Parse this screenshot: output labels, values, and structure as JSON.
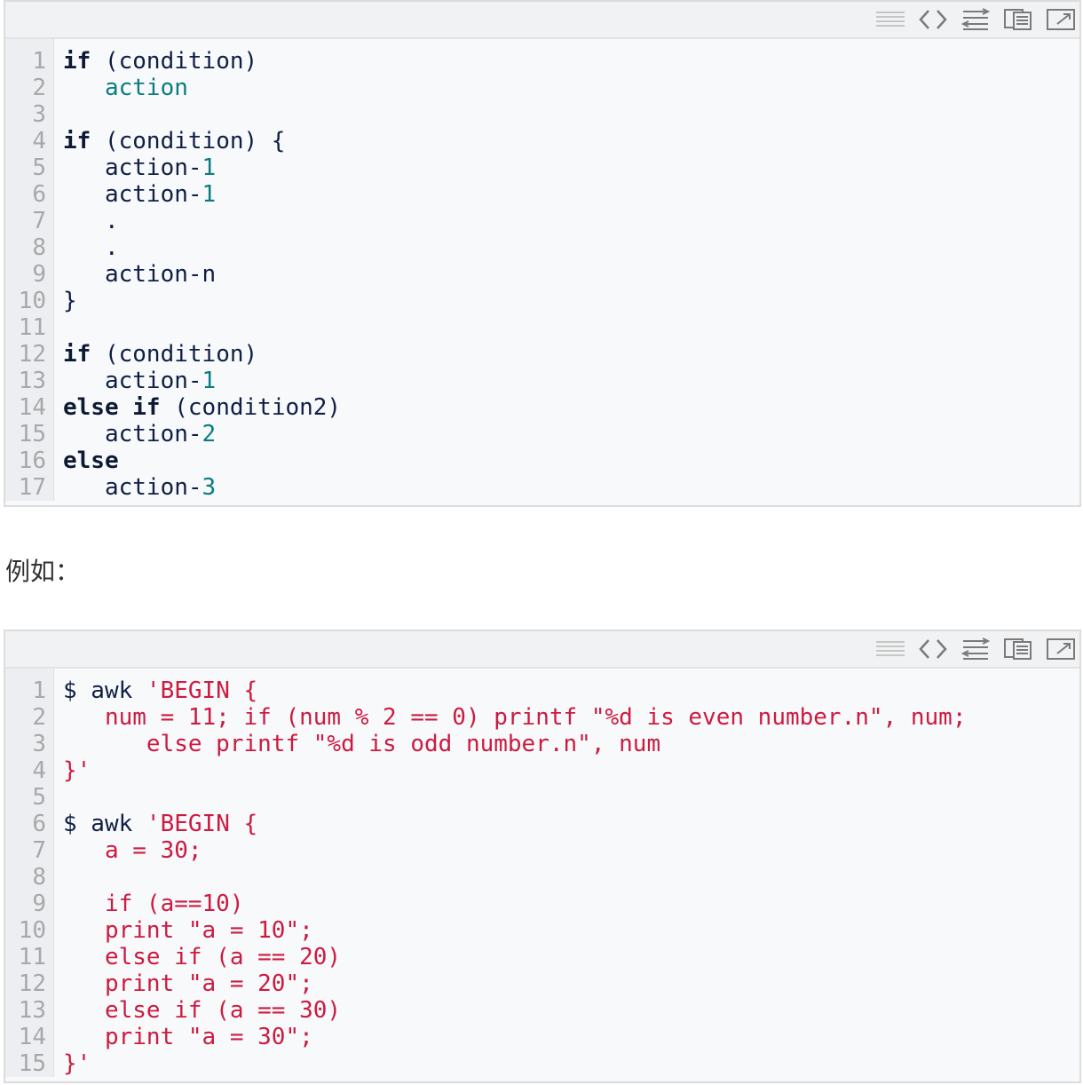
{
  "toolbar": {
    "icons": [
      "view-source-icon",
      "code-icon",
      "wrap-lines-icon",
      "copy-icon",
      "popout-icon"
    ]
  },
  "block1": {
    "lines": [
      {
        "n": "1",
        "segs": [
          {
            "t": "if",
            "c": "kw"
          },
          {
            "t": " (condition)",
            "c": "pl"
          }
        ]
      },
      {
        "n": "2",
        "segs": [
          {
            "t": "   ",
            "c": "pl"
          },
          {
            "t": "action",
            "c": "vr"
          }
        ]
      },
      {
        "n": "3",
        "segs": []
      },
      {
        "n": "4",
        "segs": [
          {
            "t": "if",
            "c": "kw"
          },
          {
            "t": " (condition) {",
            "c": "pl"
          }
        ]
      },
      {
        "n": "5",
        "segs": [
          {
            "t": "   action-",
            "c": "pl"
          },
          {
            "t": "1",
            "c": "vr"
          }
        ]
      },
      {
        "n": "6",
        "segs": [
          {
            "t": "   action-",
            "c": "pl"
          },
          {
            "t": "1",
            "c": "vr"
          }
        ]
      },
      {
        "n": "7",
        "segs": [
          {
            "t": "   .",
            "c": "pl"
          }
        ]
      },
      {
        "n": "8",
        "segs": [
          {
            "t": "   .",
            "c": "pl"
          }
        ]
      },
      {
        "n": "9",
        "segs": [
          {
            "t": "   action-n",
            "c": "pl"
          }
        ]
      },
      {
        "n": "10",
        "segs": [
          {
            "t": "}",
            "c": "pl"
          }
        ]
      },
      {
        "n": "11",
        "segs": []
      },
      {
        "n": "12",
        "segs": [
          {
            "t": "if",
            "c": "kw"
          },
          {
            "t": " (condition)",
            "c": "pl"
          }
        ]
      },
      {
        "n": "13",
        "segs": [
          {
            "t": "   action-",
            "c": "pl"
          },
          {
            "t": "1",
            "c": "vr"
          }
        ]
      },
      {
        "n": "14",
        "segs": [
          {
            "t": "else",
            "c": "kw"
          },
          {
            "t": " ",
            "c": "pl"
          },
          {
            "t": "if",
            "c": "kw"
          },
          {
            "t": " (condition2)",
            "c": "pl"
          }
        ]
      },
      {
        "n": "15",
        "segs": [
          {
            "t": "   action-",
            "c": "pl"
          },
          {
            "t": "2",
            "c": "vr"
          }
        ]
      },
      {
        "n": "16",
        "segs": [
          {
            "t": "else",
            "c": "kw"
          }
        ]
      },
      {
        "n": "17",
        "segs": [
          {
            "t": "   action-",
            "c": "pl"
          },
          {
            "t": "3",
            "c": "vr"
          }
        ]
      }
    ]
  },
  "caption": "例如：",
  "block2": {
    "lines": [
      {
        "n": "1",
        "segs": [
          {
            "t": "$ awk ",
            "c": "pl"
          },
          {
            "t": "'BEGIN {",
            "c": "red"
          }
        ]
      },
      {
        "n": "2",
        "segs": [
          {
            "t": "   num = 11; if (num % 2 == 0) printf \"%d is even number.n\", num;",
            "c": "red"
          }
        ]
      },
      {
        "n": "3",
        "segs": [
          {
            "t": "      else printf \"%d is odd number.n\", num",
            "c": "red"
          }
        ]
      },
      {
        "n": "4",
        "segs": [
          {
            "t": "}'",
            "c": "red"
          }
        ]
      },
      {
        "n": "5",
        "segs": []
      },
      {
        "n": "6",
        "segs": [
          {
            "t": "$ awk ",
            "c": "pl"
          },
          {
            "t": "'BEGIN {",
            "c": "red"
          }
        ]
      },
      {
        "n": "7",
        "segs": [
          {
            "t": "   a = 30;",
            "c": "red"
          }
        ]
      },
      {
        "n": "8",
        "segs": []
      },
      {
        "n": "9",
        "segs": [
          {
            "t": "   if (a==10)",
            "c": "red"
          }
        ]
      },
      {
        "n": "10",
        "segs": [
          {
            "t": "   print \"a = 10\";",
            "c": "red"
          }
        ]
      },
      {
        "n": "11",
        "segs": [
          {
            "t": "   else if (a == 20)",
            "c": "red"
          }
        ]
      },
      {
        "n": "12",
        "segs": [
          {
            "t": "   print \"a = 20\";",
            "c": "red"
          }
        ]
      },
      {
        "n": "13",
        "segs": [
          {
            "t": "   else if (a == 30)",
            "c": "red"
          }
        ]
      },
      {
        "n": "14",
        "segs": [
          {
            "t": "   print \"a = 30\";",
            "c": "red"
          }
        ]
      },
      {
        "n": "15",
        "segs": [
          {
            "t": "}'",
            "c": "red"
          }
        ]
      }
    ]
  }
}
